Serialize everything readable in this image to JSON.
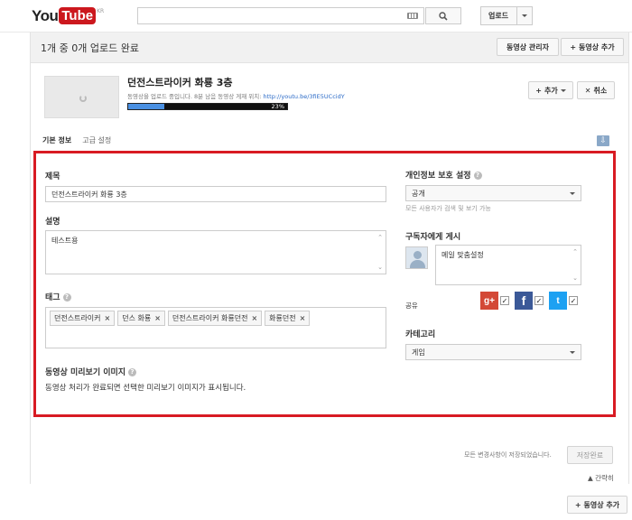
{
  "header": {
    "logo_you": "You",
    "logo_tube": "Tube",
    "logo_region": "KR",
    "search_placeholder": "",
    "upload_label": "업로드"
  },
  "status_bar": {
    "text": "1개 중 0개 업로드 완료",
    "video_manager_label": "동영상 관리자",
    "add_video_label": "동영상 추가"
  },
  "video": {
    "title": "던전스트라이커 화룡 3층",
    "status_prefix": "동영상을 업로드 중입니다. 8분 남음 동영상 게재 위치:",
    "link": "http://youtu.be/3fiE5UCcidY",
    "progress_percent": 23,
    "progress_label": "23%",
    "plus_label": "추가",
    "cancel_label": "취소"
  },
  "tabs": [
    {
      "label": "기본 정보",
      "active": true
    },
    {
      "label": "고급 설정",
      "active": false
    }
  ],
  "form": {
    "title_label": "제목",
    "title_value": "던전스트라이커 화룡 3층",
    "description_label": "설명",
    "description_value": "테스트용",
    "tags_label": "태그",
    "tags": [
      "던전스트라이커",
      "던스 화룡",
      "던전스트라이커 화룡던전",
      "화룡던전"
    ],
    "thumbnail_label": "동영상 미리보기 이미지",
    "thumbnail_message": "동영상 처리가 완료되면 선택한 미리보기 이미지가 표시됩니다.",
    "privacy_label": "개인정보 보호 설정",
    "privacy_value": "공개",
    "privacy_hint": "모든 사용자가 검색 및 보기 가능",
    "subscriber_label": "구독자에게 게시",
    "subscriber_message": "메일 맞춤설정",
    "share_label": "공유",
    "category_label": "카테고리",
    "category_value": "게임"
  },
  "footer": {
    "saved_message": "모든 변경사항이 저장되었습니다.",
    "save_label": "저장완료",
    "collapse_label": "▲ 간략히",
    "bottom_add_label": "동영상 추가"
  },
  "colors": {
    "highlight_border": "#d81b23",
    "progress_fill": "#4a90e2",
    "link": "#2a6ac7"
  }
}
